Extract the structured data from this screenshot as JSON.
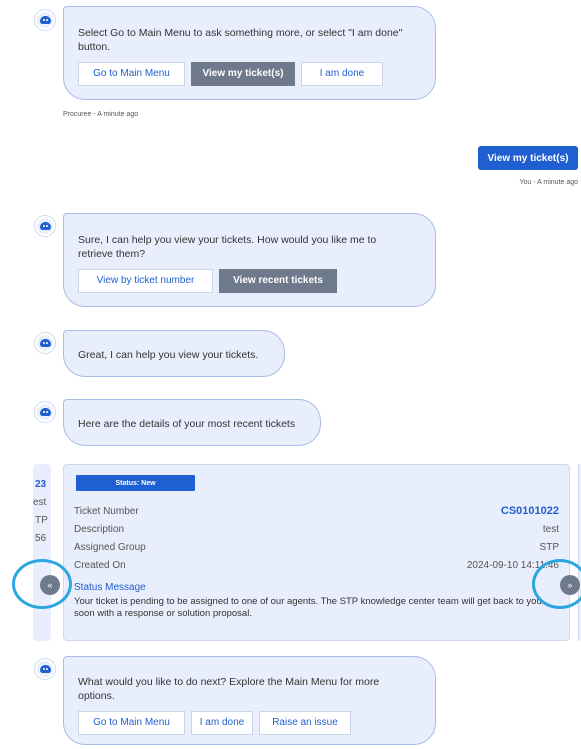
{
  "messages": {
    "m1": {
      "text": "Select Go to Main Menu to ask something more, or select \"I am done\" button.",
      "buttons": [
        "Go to Main Menu",
        "View my ticket(s)",
        "I am done"
      ],
      "meta": "Procuree - A minute ago"
    },
    "user1": {
      "text": "View my ticket(s)",
      "meta": "You - A minute ago"
    },
    "m2": {
      "text": "Sure, I can help you view your tickets. How would you like me to retrieve them?",
      "buttons": [
        "View by ticket number",
        "View recent tickets"
      ]
    },
    "m3": {
      "text": "Great, I can help you view your tickets."
    },
    "m4": {
      "text": "Here are the details of your most recent tickets"
    },
    "m5": {
      "text": "What would you like to do next? Explore the Main Menu for more options.",
      "buttons": [
        "Go to Main Menu",
        "I am done",
        "Raise an issue"
      ]
    }
  },
  "ticket": {
    "status": "Status: New",
    "fields": [
      {
        "label": "Ticket Number",
        "value": "CS0101022"
      },
      {
        "label": "Description",
        "value": "test"
      },
      {
        "label": "Assigned Group",
        "value": "STP"
      },
      {
        "label": "Created On",
        "value": "2024-09-10 14:11:46"
      }
    ],
    "status_message_label": "Status Message",
    "status_message": "Your ticket is pending to be assigned to one of our agents. The STP knowledge center team will get back to you soon with a response or solution proposal."
  },
  "prev_card": {
    "lines": [
      "23",
      "est",
      "TP",
      "56"
    ]
  },
  "carousel": {
    "prev_icon": "chevron-double-left-icon",
    "next_icon": "chevron-double-right-icon",
    "prev_glyph": "«",
    "next_glyph": "»"
  },
  "colors": {
    "accent": "#1f5fd1",
    "bubble": "#e8eefb",
    "highlight_ring": "#2aa7e0",
    "dark_button": "#6e7a8c"
  }
}
